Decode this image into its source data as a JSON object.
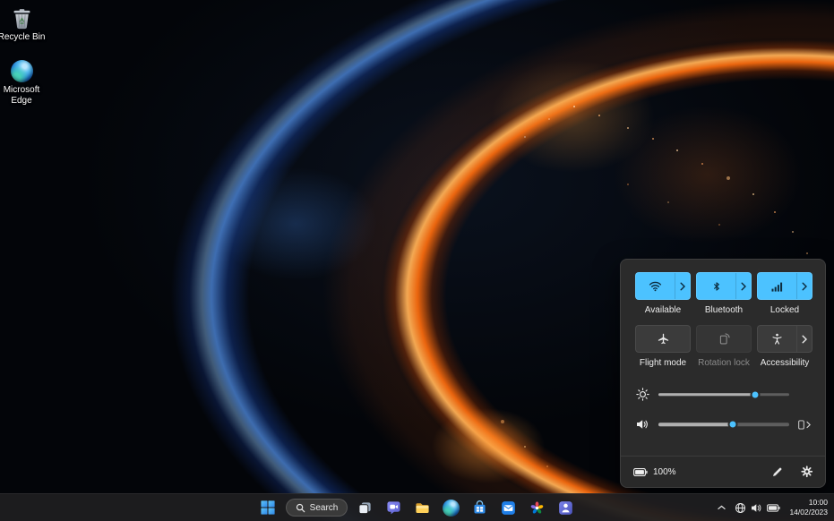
{
  "colors": {
    "accent": "#4cc2ff",
    "panel_bg": "#2c2c2c",
    "taskbar_bg": "#1d1e20"
  },
  "desktop": {
    "icons": [
      {
        "name": "recycle-bin",
        "label": "Recycle Bin",
        "icon": "recycle-bin-icon"
      },
      {
        "name": "microsoft-edge",
        "label": "Microsoft Edge",
        "icon": "edge-icon"
      }
    ]
  },
  "quick_settings": {
    "toggles": [
      {
        "name": "wifi",
        "label": "Available",
        "icon": "wifi-icon",
        "state": "on",
        "has_chevron": true
      },
      {
        "name": "bluetooth",
        "label": "Bluetooth",
        "icon": "bluetooth-icon",
        "state": "on",
        "has_chevron": true
      },
      {
        "name": "cellular",
        "label": "Locked",
        "icon": "cellular-signal-icon",
        "state": "on",
        "has_chevron": true
      },
      {
        "name": "flight-mode",
        "label": "Flight mode",
        "icon": "airplane-icon",
        "state": "off",
        "has_chevron": false
      },
      {
        "name": "rotation-lock",
        "label": "Rotation lock",
        "icon": "rotation-lock-icon",
        "state": "disabled",
        "has_chevron": false
      },
      {
        "name": "accessibility",
        "label": "Accessibility",
        "icon": "accessibility-icon",
        "state": "off",
        "has_chevron": true
      }
    ],
    "brightness": {
      "icon": "brightness-icon",
      "value": 74
    },
    "volume": {
      "icon": "speaker-icon",
      "value": 57,
      "device_icon": "audio-device-icon"
    },
    "footer": {
      "battery_icon": "battery-icon",
      "battery_label": "100%",
      "edit_icon": "pencil-icon",
      "settings_icon": "gear-icon"
    }
  },
  "taskbar": {
    "start_icon": "windows-start-icon",
    "search": {
      "icon": "search-icon",
      "label": "Search"
    },
    "apps": [
      "task-view",
      "chat",
      "file-explorer",
      "microsoft-edge",
      "microsoft-store",
      "mail",
      "photos",
      "microsoft-teams"
    ],
    "tray": {
      "hidden_icons_chevron": "chevron-up-icon",
      "icons": [
        "network-globe-icon",
        "volume-icon",
        "battery-icon"
      ],
      "time": "10:00",
      "date": "14/02/2023"
    }
  }
}
